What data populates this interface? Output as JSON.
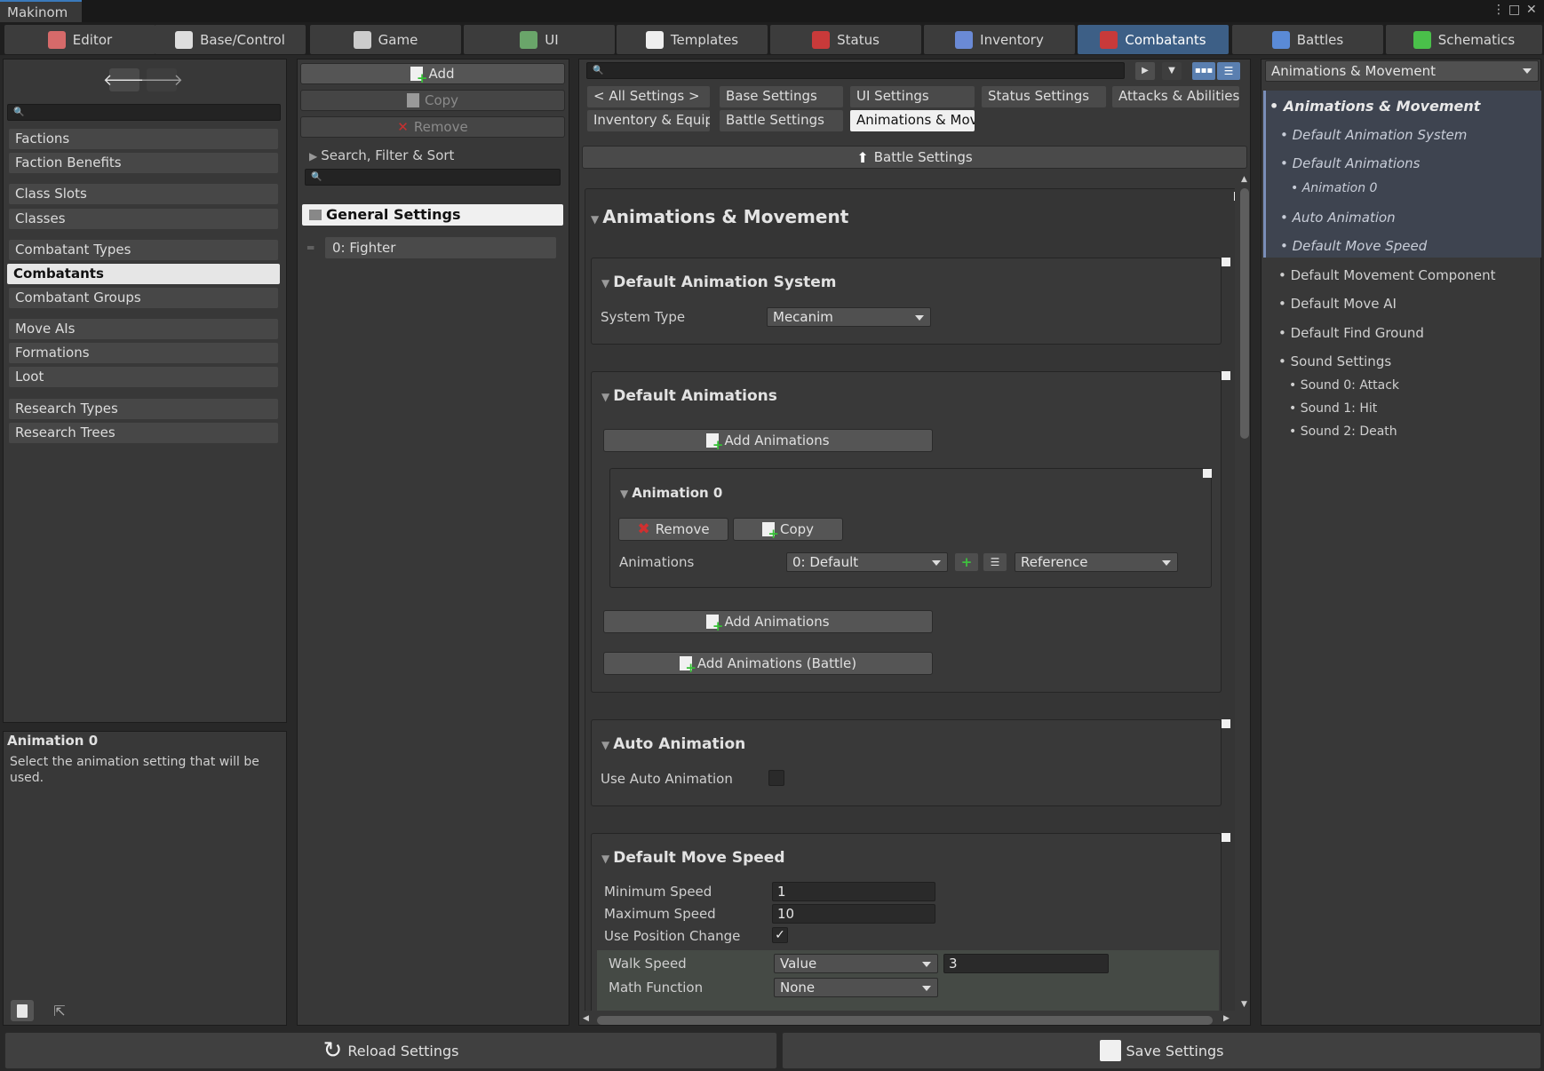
{
  "window": {
    "title": "Makinom"
  },
  "tabs": [
    {
      "label": "Editor",
      "icon": "wrench-icon",
      "color": "#d66a6a"
    },
    {
      "label": "Base/Control",
      "icon": "gamepad-icon",
      "color": "#dddddd"
    },
    {
      "label": "Game",
      "icon": "dice-icon",
      "color": "#cccccc"
    },
    {
      "label": "UI",
      "icon": "ui-icon",
      "color": "#6aa56a"
    },
    {
      "label": "Templates",
      "icon": "document-icon",
      "color": "#eeeeee"
    },
    {
      "label": "Status",
      "icon": "heart-icon",
      "color": "#c83a3a"
    },
    {
      "label": "Inventory",
      "icon": "potion-icon",
      "color": "#6a8ad6"
    },
    {
      "label": "Combatants",
      "icon": "combatant-icon",
      "color": "#c83a3a"
    },
    {
      "label": "Battles",
      "icon": "swords-icon",
      "color": "#5a8ad6"
    },
    {
      "label": "Schematics",
      "icon": "schematic-icon",
      "color": "#4ac04a"
    }
  ],
  "sidebar": {
    "items": [
      "Factions",
      "Faction Benefits",
      "Class Slots",
      "Classes",
      "Combatant Types",
      "Combatants",
      "Combatant Groups",
      "Move AIs",
      "Formations",
      "Loot",
      "Research Types",
      "Research Trees"
    ],
    "selected": "Combatants"
  },
  "help": {
    "title": "Animation 0",
    "text": "Select the animation setting that will be used."
  },
  "list_panel": {
    "add": "Add",
    "copy": "Copy",
    "remove": "Remove",
    "search_filter": "Search, Filter & Sort",
    "general_settings": "General Settings",
    "items": [
      "0: Fighter"
    ]
  },
  "settings_tabs": {
    "row1": [
      "< All Settings >",
      "Base Settings",
      "UI Settings",
      "Status Settings",
      "Attacks & Abilities"
    ],
    "row2": [
      "Inventory & Equipr",
      "Battle Settings",
      "Animations & Mov"
    ],
    "selected": "Animations & Mov"
  },
  "breadcrumb_button": "Battle Settings",
  "content": {
    "section_title": "Animations & Movement",
    "default_animation_system": {
      "title": "Default Animation System",
      "system_type_label": "System Type",
      "system_type_value": "Mecanim"
    },
    "default_animations": {
      "title": "Default Animations",
      "add_animations": "Add Animations",
      "add_animations_battle": "Add Animations (Battle)",
      "animation0": {
        "title": "Animation 0",
        "remove": "Remove",
        "copy": "Copy",
        "animations_label": "Animations",
        "animations_value": "0: Default",
        "reference_value": "Reference"
      }
    },
    "auto_animation": {
      "title": "Auto Animation",
      "use_label": "Use Auto Animation",
      "checked": false
    },
    "default_move_speed": {
      "title": "Default Move Speed",
      "min_label": "Minimum Speed",
      "min_value": "1",
      "max_label": "Maximum Speed",
      "max_value": "10",
      "use_position_label": "Use Position Change",
      "use_position_checked": true,
      "walk_label": "Walk Speed",
      "walk_type": "Value",
      "walk_value": "3",
      "math_label": "Math Function",
      "math_value": "None"
    }
  },
  "outline": {
    "dropdown": "Animations & Movement",
    "items": [
      {
        "label": "Animations & Movement",
        "level": 0,
        "active": true
      },
      {
        "label": "Default Animation System",
        "level": 1,
        "active": true
      },
      {
        "label": "Default Animations",
        "level": 1,
        "active": true
      },
      {
        "label": "Animation 0",
        "level": 2,
        "active": true
      },
      {
        "label": "Auto Animation",
        "level": 1,
        "active": true
      },
      {
        "label": "Default Move Speed",
        "level": 1,
        "active": true
      },
      {
        "label": "Default Movement Component",
        "level": 1,
        "active": false
      },
      {
        "label": "Default Move AI",
        "level": 1,
        "active": false
      },
      {
        "label": "Default Find Ground",
        "level": 1,
        "active": false
      },
      {
        "label": "Sound Settings",
        "level": 1,
        "active": false
      },
      {
        "label": "Sound 0: Attack",
        "level": 2,
        "active": false
      },
      {
        "label": "Sound 1: Hit",
        "level": 2,
        "active": false
      },
      {
        "label": "Sound 2: Death",
        "level": 2,
        "active": false
      }
    ]
  },
  "footer": {
    "reload": "Reload Settings",
    "save": "Save Settings"
  }
}
